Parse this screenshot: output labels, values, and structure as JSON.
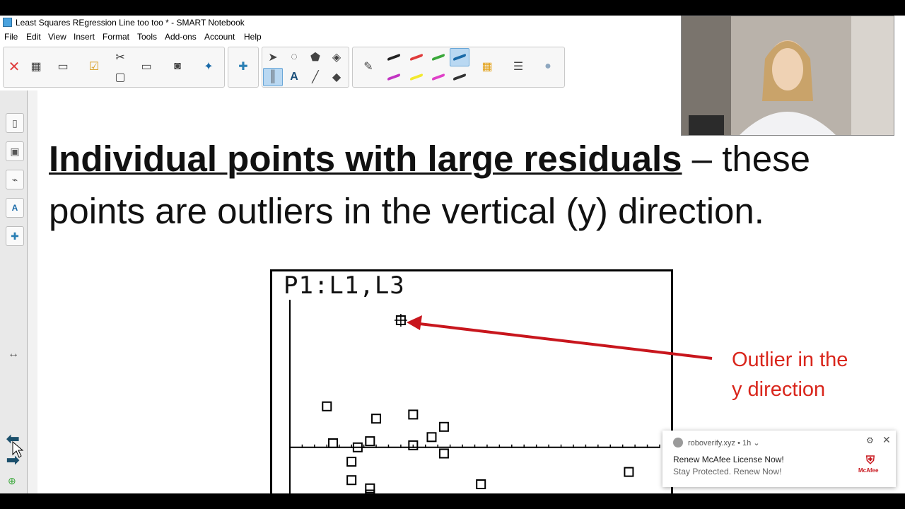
{
  "window": {
    "title": "Least Squares REgression Line  too too * - SMART Notebook"
  },
  "menu": [
    "File",
    "Edit",
    "View",
    "Insert",
    "Format",
    "Tools",
    "Add-ons",
    "Account",
    "Help"
  ],
  "slide": {
    "headline_bold": "Individual points with large residuals",
    "headline_rest_line1": " – these",
    "headline_line2": "points are outliers in the vertical (y) direction.",
    "graph_label": "P1:L1,L3",
    "callout_line1": "Outlier in the",
    "callout_line2": "y direction"
  },
  "colors": {
    "callout": "#d9261c",
    "arrow": "#c8161d",
    "accent_blue": "#1a6aa8"
  },
  "chart_data": {
    "type": "scatter",
    "title": "P1:L1,L3",
    "xlabel": "",
    "ylabel": "",
    "grid": false,
    "points": [
      {
        "x": 0.6,
        "y": 1.0
      },
      {
        "x": 0.7,
        "y": 0.1
      },
      {
        "x": 1.0,
        "y": -0.35
      },
      {
        "x": 1.0,
        "y": -0.8
      },
      {
        "x": 1.1,
        "y": 0.0
      },
      {
        "x": 1.3,
        "y": 0.15
      },
      {
        "x": 1.3,
        "y": -1.0
      },
      {
        "x": 1.3,
        "y": -1.15
      },
      {
        "x": 1.4,
        "y": 0.7
      },
      {
        "x": 2.0,
        "y": 0.8
      },
      {
        "x": 2.0,
        "y": 0.05
      },
      {
        "x": 2.3,
        "y": 0.25
      },
      {
        "x": 2.5,
        "y": 0.5
      },
      {
        "x": 2.5,
        "y": -0.15
      },
      {
        "x": 3.1,
        "y": -0.9
      },
      {
        "x": 5.5,
        "y": -0.6
      },
      {
        "x": 1.8,
        "y": 3.1
      }
    ],
    "outlier_index": 16,
    "xlim": [
      0,
      6.0
    ],
    "ylim": [
      -1.4,
      3.6
    ]
  },
  "notification": {
    "source": "roboverify.xyz",
    "age": "1h",
    "line1": "Renew McAfee License Now!",
    "line2": "Stay Protected. Renew Now!",
    "brand": "McAfee"
  }
}
